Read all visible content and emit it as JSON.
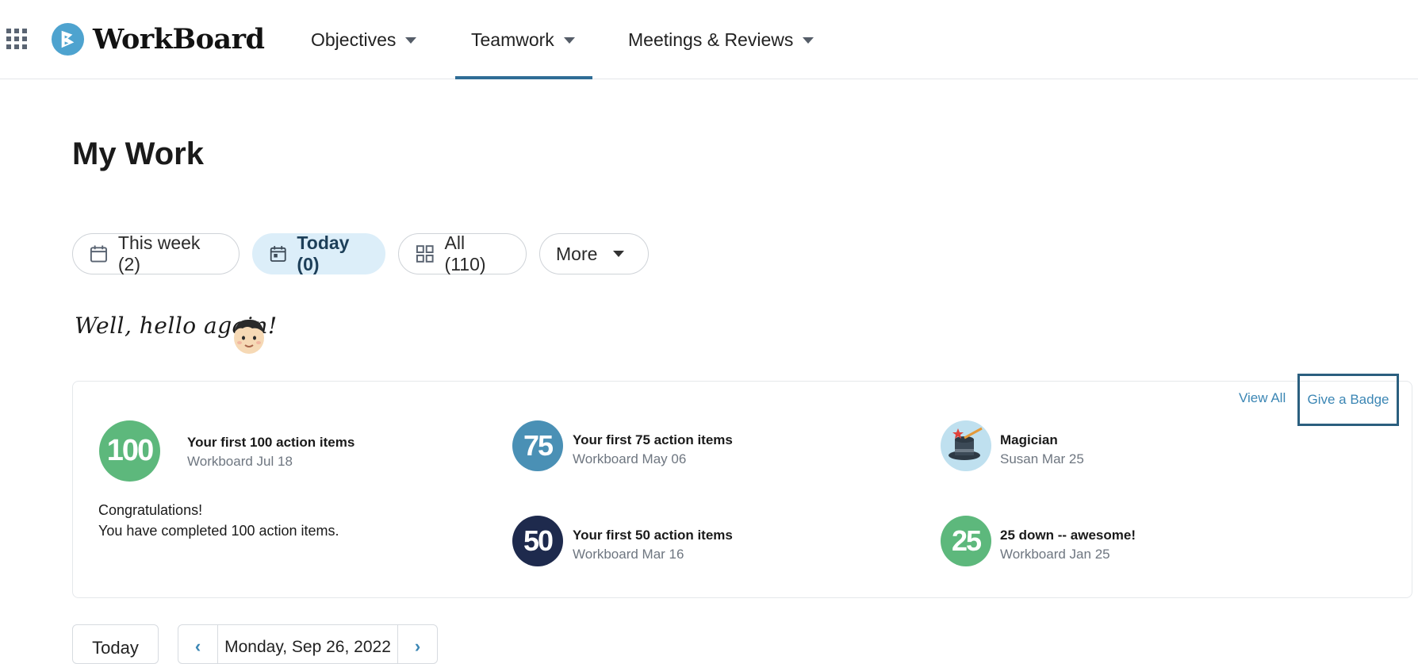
{
  "app": {
    "brand": "WorkBoard",
    "icons": {
      "apps": "apps-grid-icon",
      "logo": "workboard-logo-icon"
    }
  },
  "nav": {
    "items": [
      {
        "label": "Objectives",
        "active": false
      },
      {
        "label": "Teamwork",
        "active": true
      },
      {
        "label": "Meetings & Reviews",
        "active": false
      }
    ],
    "accent_color": "#2f6d96"
  },
  "page": {
    "title": "My Work"
  },
  "filters": [
    {
      "label": "This week (2)",
      "icon": "calendar-week-icon",
      "active": false
    },
    {
      "label": "Today (0)",
      "icon": "calendar-day-icon",
      "active": true
    },
    {
      "label": "All (110)",
      "icon": "grid-icon",
      "active": false
    },
    {
      "label": "More",
      "icon": "chevron-down-icon",
      "active": false
    }
  ],
  "greeting": {
    "text": "Well, hello again!",
    "icon": "avatar-face-icon"
  },
  "badges": {
    "view_all_label": "View All",
    "give_badge_label": "Give a Badge",
    "featured": {
      "number": "100",
      "color": "#5db87c",
      "title": "Your first 100 action items",
      "subtitle": "Workboard Jul 18",
      "message_line1": "Congratulations!",
      "message_line2": "You have completed 100 action items."
    },
    "items": [
      {
        "number": "75",
        "color": "#4a90b5",
        "title": "Your first 75 action items",
        "subtitle": "Workboard May 06"
      },
      {
        "number": "",
        "icon": "magician-hat-icon",
        "color": "#bfe0ef",
        "title": "Magician",
        "subtitle": "Susan Mar 25"
      },
      {
        "number": "50",
        "color": "#1e2a4d",
        "title": "Your first 50 action items",
        "subtitle": "Workboard Mar 16"
      },
      {
        "number": "25",
        "color": "#5db87c",
        "title": "25 down -- awesome!",
        "subtitle": "Workboard Jan 25"
      }
    ]
  },
  "date_bar": {
    "today_label": "Today",
    "current_date": "Monday, Sep 26, 2022",
    "prev_icon": "chevron-left-icon",
    "next_icon": "chevron-right-icon"
  }
}
